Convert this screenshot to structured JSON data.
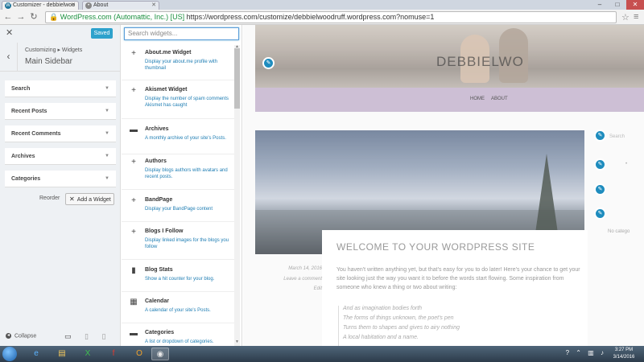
{
  "browser": {
    "tabs": [
      {
        "title": "Customizer - debbielwoo",
        "active": true
      },
      {
        "title": "About",
        "active": false
      }
    ],
    "ssl_org": "WordPress.com (Automattic, Inc.) [US]",
    "url": "https://wordpress.com/customize/debbielwoodruff.wordpress.com?nomuse=1"
  },
  "customizer": {
    "saved_label": "Saved",
    "breadcrumb": "Customizing ▸ Widgets",
    "title": "Main Sidebar",
    "sections": [
      "Search",
      "Recent Posts",
      "Recent Comments",
      "Archives",
      "Categories"
    ],
    "reorder_label": "Reorder",
    "add_widget_label": "Add a Widget",
    "collapse_label": "Collapse"
  },
  "widgets": {
    "search_placeholder": "Search widgets...",
    "items": [
      {
        "icon": "plus-icon",
        "title": "About.me Widget",
        "desc": "Display your about.me profile with thumbnail"
      },
      {
        "icon": "plus-icon",
        "title": "Akismet Widget",
        "desc": "Display the number of spam comments Akismet has caught"
      },
      {
        "icon": "archive-icon",
        "title": "Archives",
        "desc": "A monthly archive of your site's Posts."
      },
      {
        "icon": "plus-icon",
        "title": "Authors",
        "desc": "Display blogs authors with avatars and recent posts."
      },
      {
        "icon": "plus-icon",
        "title": "BandPage",
        "desc": "Display your BandPage content"
      },
      {
        "icon": "plus-icon",
        "title": "Blogs I Follow",
        "desc": "Display linked images for the blogs you follow"
      },
      {
        "icon": "chart-icon",
        "title": "Blog Stats",
        "desc": "Show a hit counter for your blog."
      },
      {
        "icon": "calendar-icon",
        "title": "Calendar",
        "desc": "A calendar of your site's Posts."
      },
      {
        "icon": "folder-icon",
        "title": "Categories",
        "desc": "A list or dropdown of categories."
      }
    ]
  },
  "preview": {
    "site_title": "DEBBIELWO",
    "menu": [
      "HOME",
      "ABOUT"
    ],
    "post_title": "WELCOME TO YOUR WORDPRESS SITE",
    "post_meta": [
      "March 14, 2016",
      "Leave a comment",
      "Edit"
    ],
    "post_body": "You haven't written anything yet, but that's easy for you to do later! Here's your chance to get your site looking just the way you want it to before the words start flowing. Some inspiration from someone who knew a thing or two about writing:",
    "verse": [
      "And as imagination bodies forth",
      "The forms of things unknown, the poet's pen",
      "Turns them to shapes and gives to airy nothing",
      "A local habitation and a name."
    ],
    "sidebar_search": "Search",
    "sidebar_nocat": "No catego"
  },
  "taskbar": {
    "time": "3:27 PM",
    "date": "3/14/2016"
  }
}
